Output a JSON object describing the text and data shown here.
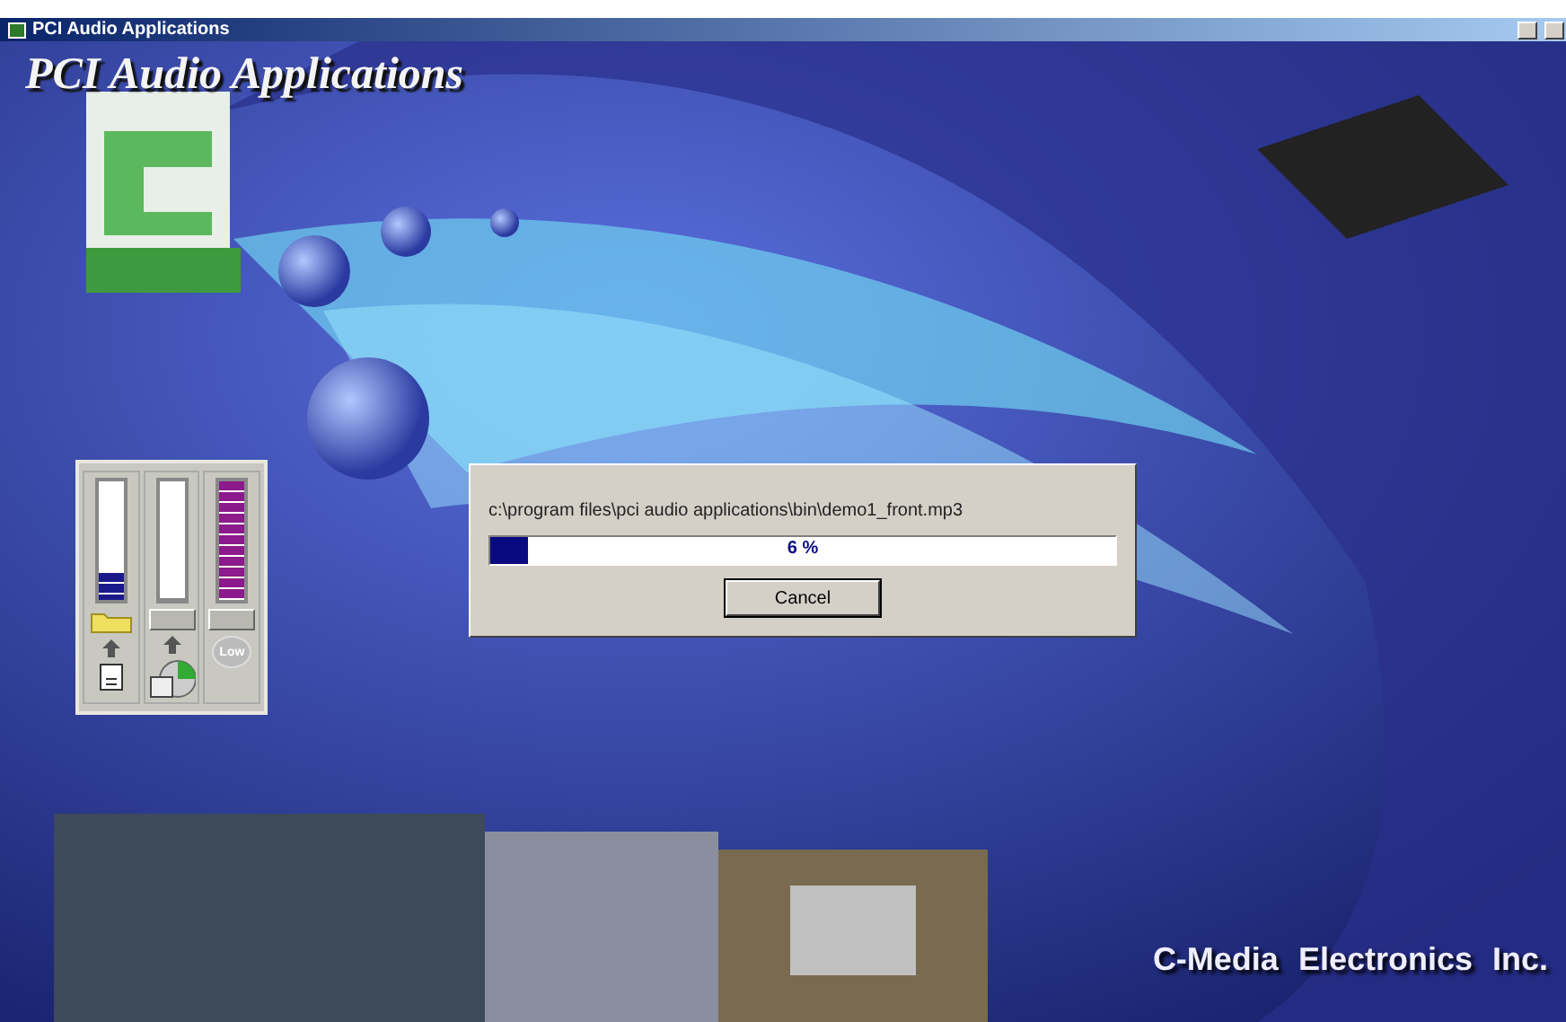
{
  "window": {
    "title": "PCI Audio Applications"
  },
  "splash": {
    "heading": "PCI Audio Applications",
    "company": "C-Media Electronics Inc."
  },
  "meters": [
    {
      "level": 0.22,
      "color": "#1a1a8c"
    },
    {
      "level": 0
    },
    {
      "level": 1,
      "color": "#8c1a8c"
    }
  ],
  "meter_controls": {
    "low_button": "Low"
  },
  "progress_dialog": {
    "file": "c:\\program files\\pci audio applications\\bin\\demo1_front.mp3",
    "level": 0.06,
    "reading": "6 %",
    "button": "Cancel"
  }
}
